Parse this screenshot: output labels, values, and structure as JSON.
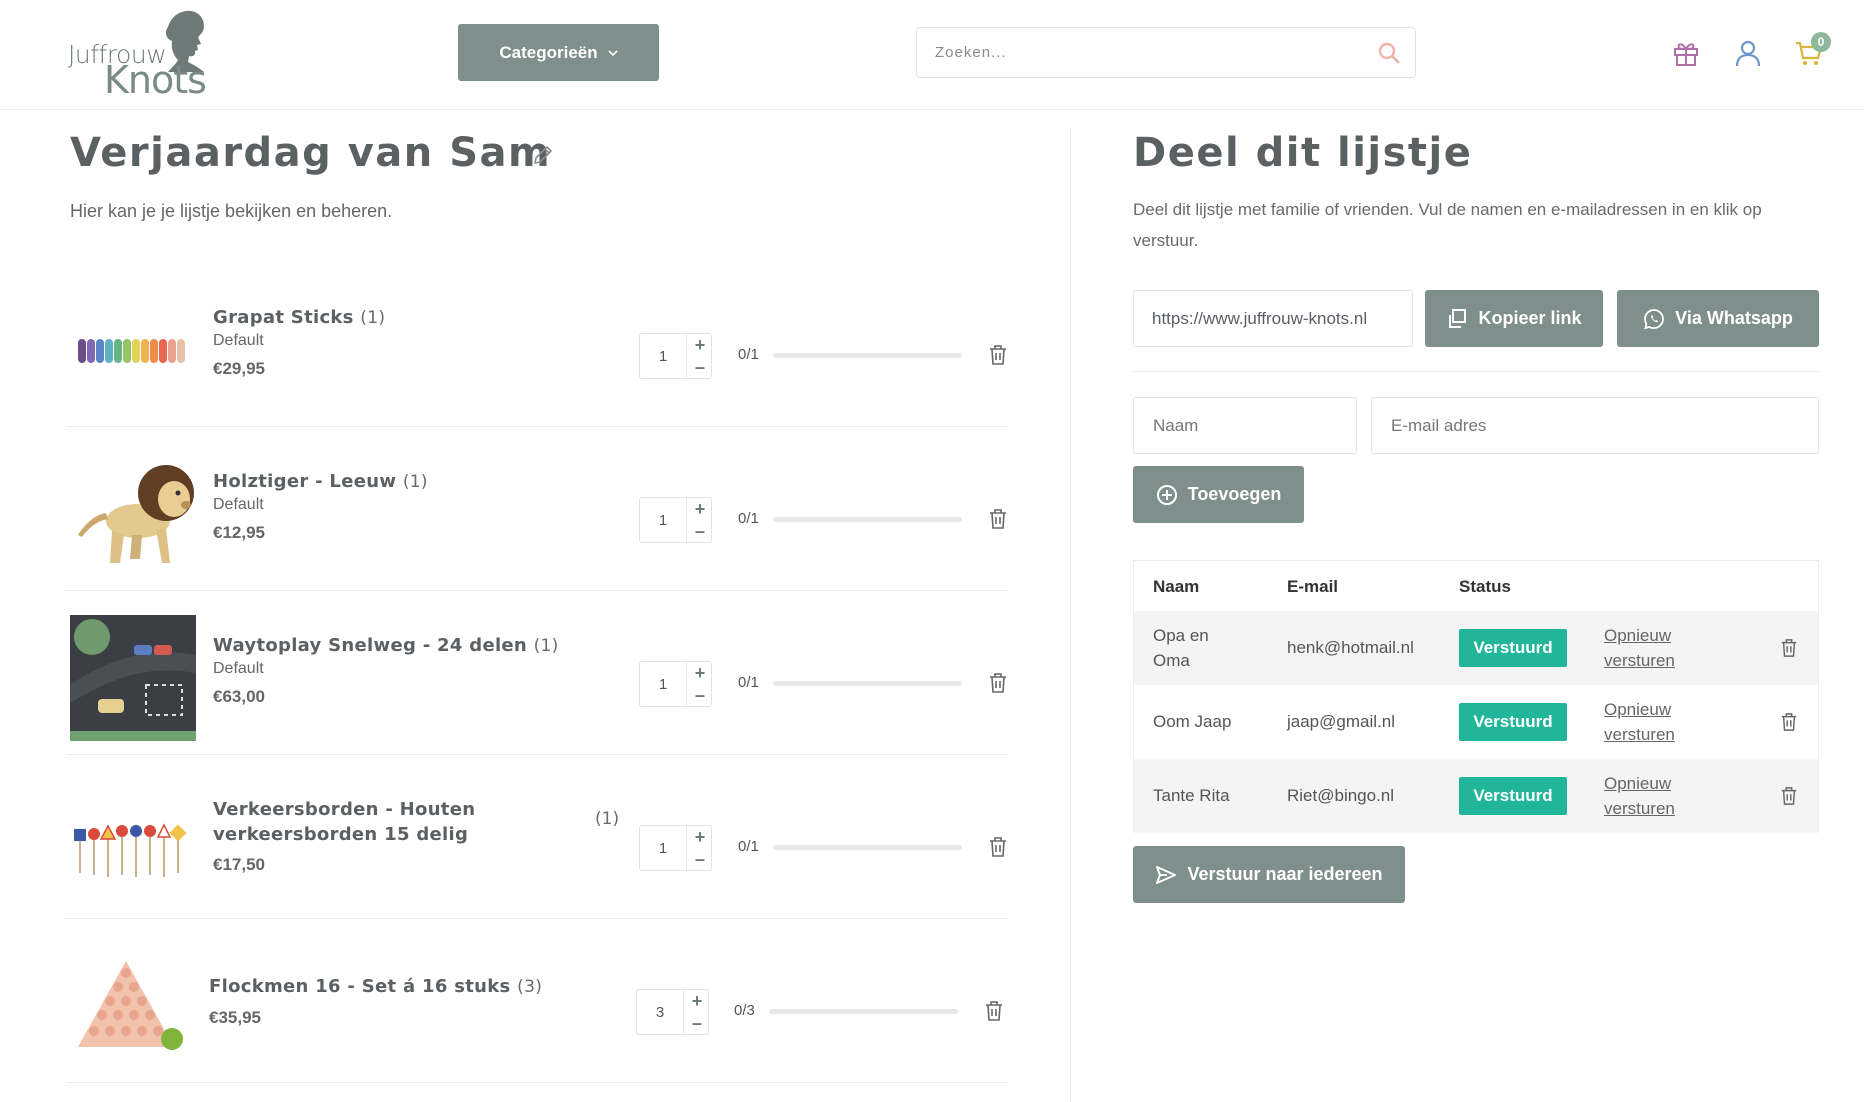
{
  "header": {
    "logo_line1": "Juffrouw",
    "logo_line2": "Knots",
    "categories_label": "Categorieën",
    "search_placeholder": "Zoeken...",
    "cart_count": "0",
    "colors": {
      "primary": "#7f8f8b",
      "gift": "#b06fa8",
      "user": "#6f97c7",
      "cart": "#d7b43c",
      "badge": "#8fb89a"
    }
  },
  "wishlist": {
    "title": "Verjaardag van Sam",
    "subtitle": "Hier kan je je lijstje bekijken en beheren.",
    "items": [
      {
        "name": "Grapat Sticks",
        "qty_tag": "(1)",
        "variant": "Default",
        "price": "€29,95",
        "qty": "1",
        "progress_label": "0/1",
        "fulfilled": 0,
        "total": 1
      },
      {
        "name": "Holztiger - Leeuw",
        "qty_tag": "(1)",
        "variant": "Default",
        "price": "€12,95",
        "qty": "1",
        "progress_label": "0/1",
        "fulfilled": 0,
        "total": 1
      },
      {
        "name": "Waytoplay Snelweg - 24 delen",
        "qty_tag": "(1)",
        "variant": "Default",
        "price": "€63,00",
        "qty": "1",
        "progress_label": "0/1",
        "fulfilled": 0,
        "total": 1
      },
      {
        "name_line1": "Verkeersborden - Houten",
        "name_line2": "verkeersborden 15 delig",
        "qty_tag": "(1)",
        "price": "€17,50",
        "qty": "1",
        "progress_label": "0/1",
        "fulfilled": 0,
        "total": 1
      },
      {
        "name": "Flockmen 16 - Set á 16 stuks",
        "qty_tag": "(3)",
        "price": "€35,95",
        "qty": "3",
        "progress_label": "0/3",
        "fulfilled": 0,
        "total": 3
      }
    ]
  },
  "share": {
    "title": "Deel dit lijstje",
    "description": "Deel dit lijstje met familie of vrienden. Vul de namen en e-mailadressen in en klik op verstuur.",
    "link_value": "https://www.juffrouw-knots.nl",
    "copy_label": "Kopieer link",
    "whatsapp_label": "Via Whatsapp",
    "name_placeholder": "Naam",
    "email_placeholder": "E-mail adres",
    "add_label": "Toevoegen",
    "table": {
      "headers": {
        "name": "Naam",
        "email": "E-mail",
        "status": "Status"
      },
      "rows": [
        {
          "name_line1": "Opa en",
          "name_line2": "Oma",
          "email": "henk@hotmail.nl",
          "status": "Verstuurd",
          "resend_line1": "Opnieuw",
          "resend_line2": "versturen"
        },
        {
          "name": "Oom Jaap",
          "email": "jaap@gmail.nl",
          "status": "Verstuurd",
          "resend_line1": "Opnieuw",
          "resend_line2": "versturen"
        },
        {
          "name": "Tante Rita",
          "email": "Riet@bingo.nl",
          "status": "Verstuurd",
          "resend_line1": "Opnieuw",
          "resend_line2": "versturen"
        }
      ]
    },
    "send_all_label": "Verstuur naar iedereen"
  }
}
